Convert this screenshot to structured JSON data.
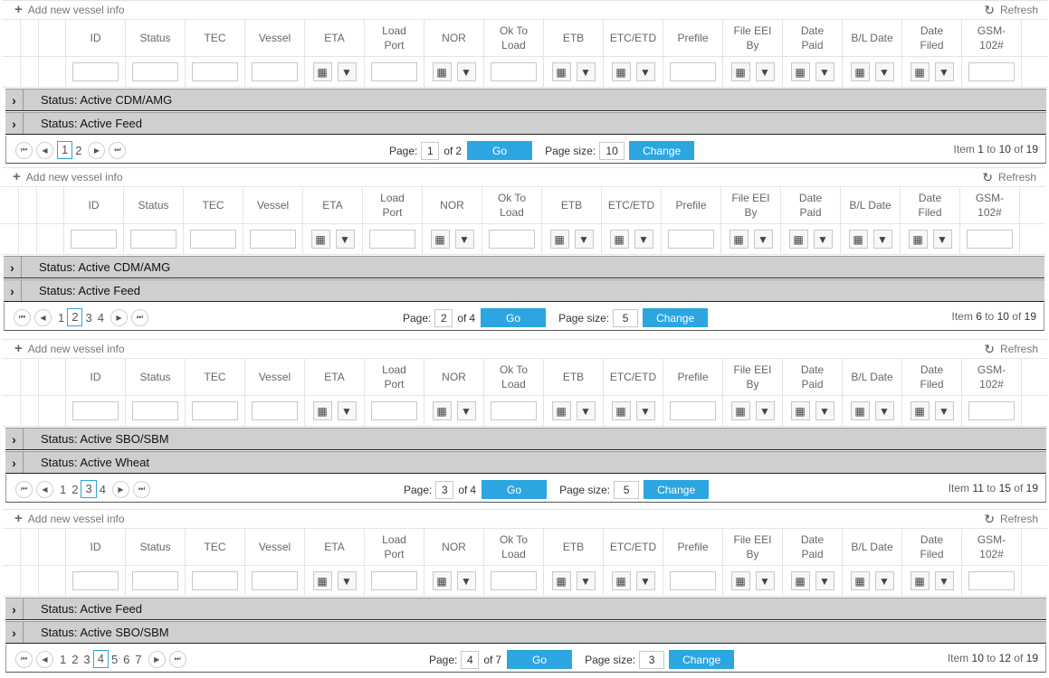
{
  "toolbar": {
    "add_label": "Add new vessel info",
    "refresh_label": "Refresh"
  },
  "columns": [
    "ID",
    "Status",
    "TEC",
    "Vessel",
    "ETA",
    "Load\nPort",
    "NOR",
    "Ok To\nLoad",
    "ETB",
    "ETC/ETD",
    "Prefile",
    "File EEI\nBy",
    "Date\nPaid",
    "B/L Date",
    "Date\nFiled",
    "GSM-\n102#"
  ],
  "filter_types": [
    "text",
    "text",
    "text",
    "text",
    "date",
    "text",
    "date",
    "text",
    "date",
    "date",
    "text",
    "date",
    "date",
    "date",
    "date",
    "text"
  ],
  "icons": {
    "calendar": "calendar-icon",
    "filter": "filter-icon",
    "expand": "chevron-right-icon",
    "refresh": "refresh-icon",
    "add": "plus-icon"
  },
  "accent_color": "#2ca6e0",
  "pager_labels": {
    "page": "Page:",
    "of": "of",
    "go": "Go",
    "page_size": "Page size:",
    "change": "Change",
    "item": "Item",
    "to": "to"
  },
  "grids": [
    {
      "groups": [
        "Status: Active CDM/AMG",
        "Status: Active Feed"
      ],
      "page_numbers": [
        "1",
        "2"
      ],
      "current_page": "1",
      "total_pages": "2",
      "page_size": "10",
      "item_from": "1",
      "item_to": "10",
      "item_total": "19"
    },
    {
      "groups": [
        "Status: Active CDM/AMG",
        "Status: Active Feed"
      ],
      "page_numbers": [
        "1",
        "2",
        "3",
        "4"
      ],
      "current_page": "2",
      "total_pages": "4",
      "page_size": "5",
      "item_from": "6",
      "item_to": "10",
      "item_total": "19"
    },
    {
      "groups": [
        "Status: Active SBO/SBM",
        "Status: Active Wheat"
      ],
      "page_numbers": [
        "1",
        "2",
        "3",
        "4"
      ],
      "current_page": "3",
      "total_pages": "4",
      "page_size": "5",
      "item_from": "11",
      "item_to": "15",
      "item_total": "19"
    },
    {
      "groups": [
        "Status: Active Feed",
        "Status: Active SBO/SBM"
      ],
      "page_numbers": [
        "1",
        "2",
        "3",
        "4",
        "5",
        "6",
        "7"
      ],
      "current_page": "4",
      "total_pages": "7",
      "page_size": "3",
      "item_from": "10",
      "item_to": "12",
      "item_total": "19"
    }
  ]
}
